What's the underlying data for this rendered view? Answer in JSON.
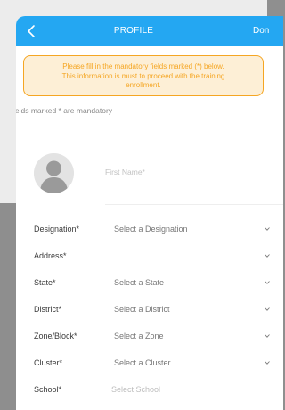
{
  "header": {
    "title": "PROFILE",
    "done_label": "Don"
  },
  "notice": {
    "line1": "Please fill in the mandatory fields marked (*) below.",
    "line2": "This information is must to proceed with the training",
    "line3": "enrollment."
  },
  "mandatory_note": "ields marked * are mandatory",
  "profile": {
    "first_name_placeholder": "First Name*",
    "first_name_value": ""
  },
  "fields": [
    {
      "label": "Designation*",
      "value": "Select a Designation"
    },
    {
      "label": "Address*",
      "value": ""
    },
    {
      "label": "State*",
      "value": "Select a State"
    },
    {
      "label": "District*",
      "value": "Select a District"
    },
    {
      "label": "Zone/Block*",
      "value": "Select a Zone"
    },
    {
      "label": "Cluster*",
      "value": "Select a Cluster"
    },
    {
      "label": "School*",
      "value": "Select School"
    }
  ],
  "colors": {
    "header_bg": "#24a7f2",
    "notice_border": "#f5a623",
    "notice_bg": "#fdefd6"
  },
  "icons": {
    "back": "chevron-left-icon",
    "avatar": "user-avatar-icon",
    "dropdown": "chevron-down-icon"
  }
}
